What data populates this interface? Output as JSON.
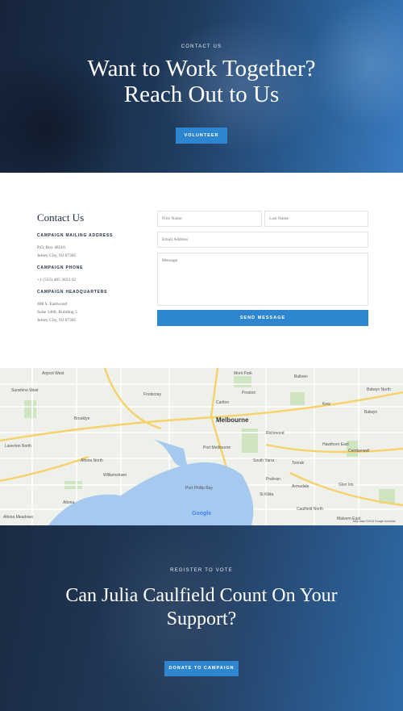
{
  "hero": {
    "eyebrow": "CONTACT US",
    "title": "Want to Work Together? Reach Out to Us",
    "button": "VOLUNTEER"
  },
  "contact": {
    "heading": "Contact Us",
    "mailing_label": "CAMPAIGN MAILING ADDRESS",
    "mailing_line1": "P.O. Box 48516",
    "mailing_line2": "Jersey City, NJ 07305",
    "phone_label": "CAMPAIGN PHONE",
    "phone": "+1 (555) 485 3023 42",
    "hq_label": "CAMPAIGN HEADQUARTERS",
    "hq_line1": "408 S. Eastwood",
    "hq_line2": "Suite 1408, Building 5",
    "hq_line3": "Jersey City, NJ 07305"
  },
  "form": {
    "first_name_placeholder": "First Name",
    "last_name_placeholder": "Last Name",
    "email_placeholder": "Email Address",
    "message_placeholder": "Message",
    "send_button": "SEND MESSAGE"
  },
  "map": {
    "city": "Melbourne",
    "bay": "Port Phillip Bay",
    "places": [
      "Airport West",
      "Mont Park",
      "Bulleen",
      "Balwyn North",
      "Sunshine West",
      "Preston",
      "Kew",
      "Balwyn",
      "Footscray",
      "Brooklyn",
      "Carlton",
      "Richmond",
      "Hawthorn East",
      "Camberwell",
      "Altona North",
      "Port Melbourne",
      "South Yarra",
      "Toorak",
      "Williamstown",
      "Prahran",
      "Armadale",
      "Glen Iris",
      "Altona",
      "St Kilda",
      "Caulfield North",
      "Altona Meadows",
      "Malvern East",
      "Laverton North"
    ],
    "google": "Google",
    "credit": "Map data ©2018 Google   Australia"
  },
  "footer": {
    "eyebrow": "REGISTER TO VOTE",
    "title": "Can Julia Caulfield Count On Your Support?",
    "button": "DONATE TO CAMPAIGN"
  },
  "colors": {
    "accent": "#2f86d0",
    "navy": "#1c2940"
  }
}
